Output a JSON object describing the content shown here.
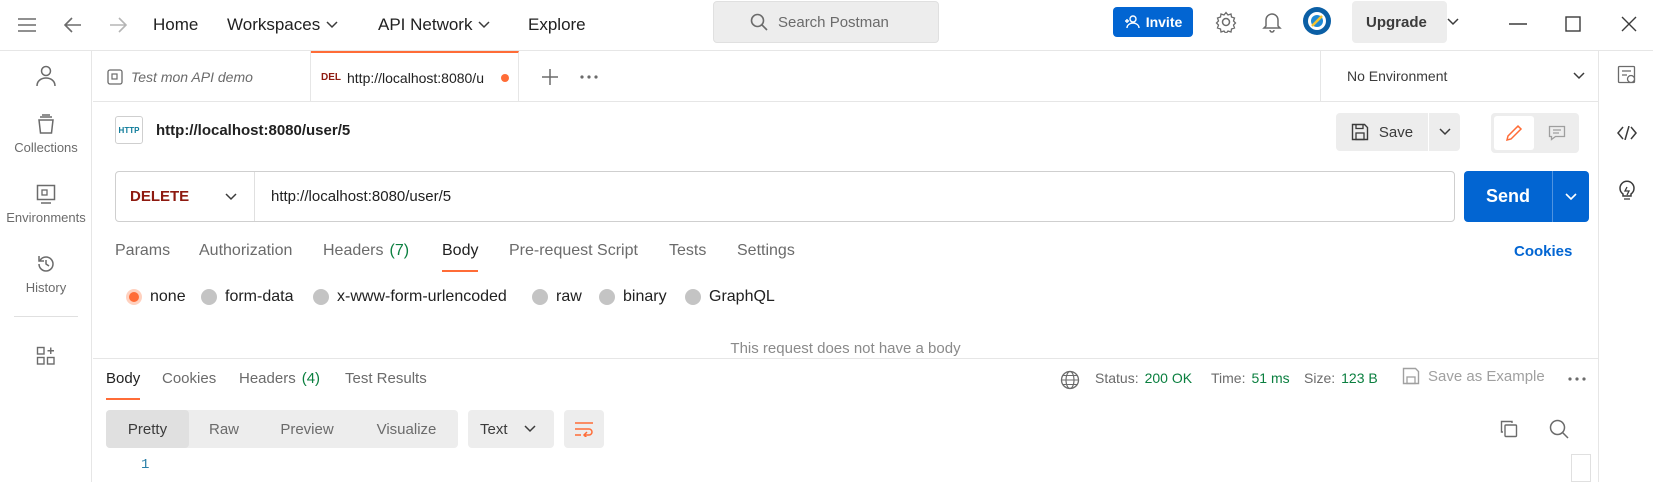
{
  "topbar": {
    "home": "Home",
    "workspaces": "Workspaces",
    "api_network": "API Network",
    "explore": "Explore",
    "search_placeholder": "Search Postman",
    "invite": "Invite",
    "upgrade": "Upgrade"
  },
  "sidebar": {
    "items": [
      {
        "label": "Collections",
        "icon": "collections-icon"
      },
      {
        "label": "Environments",
        "icon": "environments-icon"
      },
      {
        "label": "History",
        "icon": "history-icon"
      }
    ]
  },
  "tabs": {
    "items": [
      {
        "label": "Test mon API demo",
        "method": ""
      },
      {
        "label": "http://localhost:8080/u",
        "method": "DEL"
      }
    ],
    "environment": "No Environment"
  },
  "request": {
    "protocol_badge": "HTTP",
    "title": "http://localhost:8080/user/5",
    "save": "Save",
    "method": "DELETE",
    "url": "http://localhost:8080/user/5",
    "send": "Send",
    "tabs": [
      "Params",
      "Authorization",
      "Headers",
      "Body",
      "Pre-request Script",
      "Tests",
      "Settings"
    ],
    "headers_count": "(7)",
    "active_tab": "Body",
    "cookies": "Cookies",
    "body_options": [
      "none",
      "form-data",
      "x-www-form-urlencoded",
      "raw",
      "binary",
      "GraphQL"
    ],
    "selected_body_option": "none",
    "empty_body_message": "This request does not have a body"
  },
  "response": {
    "tabs": [
      "Body",
      "Cookies",
      "Headers",
      "Test Results"
    ],
    "headers_count": "(4)",
    "status_label": "Status:",
    "status_value": "200 OK",
    "time_label": "Time:",
    "time_value": "51 ms",
    "size_label": "Size:",
    "size_value": "123 B",
    "save_example": "Save as Example",
    "views": [
      "Pretty",
      "Raw",
      "Preview",
      "Visualize"
    ],
    "active_view": "Pretty",
    "format": "Text",
    "line_number": "1"
  },
  "colors": {
    "accent": "#ff6c37",
    "primary": "#0265d2",
    "method_delete": "#8e1a10",
    "status_ok": "#0a7f3f"
  }
}
